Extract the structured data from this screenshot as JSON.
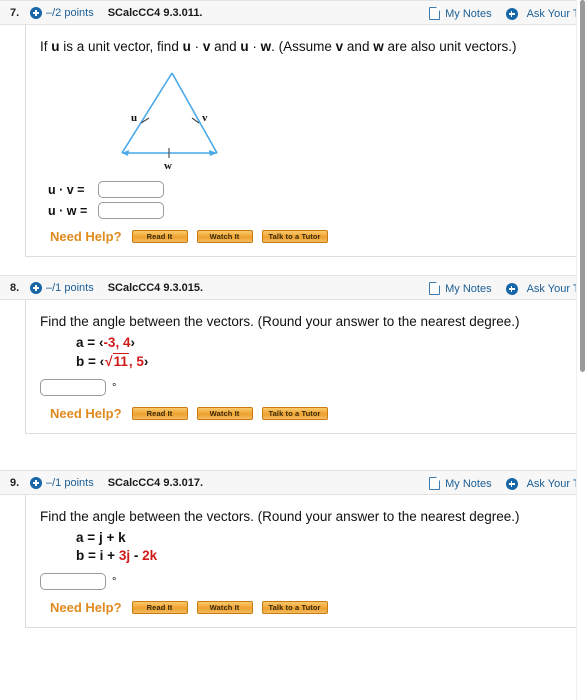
{
  "questions": [
    {
      "number": "7.",
      "points": "–/2 points",
      "code": "SCalcCC4 9.3.011.",
      "my_notes": "My Notes",
      "ask_teacher": "Ask Your Teacher",
      "prompt": "If u is a unit vector, find u · v and u · w. (Assume v and w are also unit vectors.)",
      "prompt_parts": {
        "t1": "If ",
        "b1": "u",
        "t2": " is a unit vector, find ",
        "b2": "u",
        "t3": " · ",
        "b3": "v",
        "t4": " and ",
        "b4": "u",
        "t5": " · ",
        "b5": "w",
        "t6": ". (Assume ",
        "b6": "v",
        "t7": " and ",
        "b7": "w",
        "t8": " are also unit vectors.)"
      },
      "figure": {
        "type": "triangle",
        "labels": [
          "u",
          "v",
          "w"
        ],
        "stroke_color": "#49a9e8"
      },
      "answers": [
        {
          "label": "u · v =",
          "value": "",
          "suffix": ""
        },
        {
          "label": "u · w =",
          "value": "",
          "suffix": ""
        }
      ],
      "need_help": {
        "label": "Need Help?",
        "buttons": [
          "Read It",
          "Watch It",
          "Talk to a Tutor"
        ]
      }
    },
    {
      "number": "8.",
      "points": "–/1 points",
      "code": "SCalcCC4 9.3.015.",
      "my_notes": "My Notes",
      "ask_teacher": "Ask Your Teacher",
      "prompt": "Find the angle between the vectors. (Round your answer to the nearest degree.)",
      "vectors": [
        {
          "name": "a",
          "eq": "=",
          "open": "‹",
          "c1": "-3",
          "comma": ", ",
          "c2": "4",
          "close": "›"
        },
        {
          "name": "b",
          "eq": "=",
          "open": "‹",
          "c1_radicand": "11",
          "comma": ", ",
          "c2": "5",
          "close": "›"
        }
      ],
      "answers": [
        {
          "label": "",
          "value": "",
          "suffix": "°"
        }
      ],
      "need_help": {
        "label": "Need Help?",
        "buttons": [
          "Read It",
          "Watch It",
          "Talk to a Tutor"
        ]
      }
    },
    {
      "number": "9.",
      "points": "–/1 points",
      "code": "SCalcCC4 9.3.017.",
      "my_notes": "My Notes",
      "ask_teacher": "Ask Your Teacher",
      "prompt": "Find the angle between the vectors. (Round your answer to the nearest degree.)",
      "vectors": [
        {
          "name": "a",
          "eq": "=",
          "expr_black": "j + k"
        },
        {
          "name": "b",
          "eq": "=",
          "expr_p1": "i + ",
          "expr_red1": "3j",
          "expr_p2": " - ",
          "expr_red2": "2k"
        }
      ],
      "answers": [
        {
          "label": "",
          "value": "",
          "suffix": "°"
        }
      ],
      "need_help": {
        "label": "Need Help?",
        "buttons": [
          "Read It",
          "Watch It",
          "Talk to a Tutor"
        ]
      }
    }
  ],
  "colors": {
    "link_blue": "#1c5f96",
    "accent_orange": "#e08a1e",
    "value_red": "#d01a1a",
    "figure_blue": "#49a9e8"
  },
  "scrollbar": {
    "visible": true
  }
}
